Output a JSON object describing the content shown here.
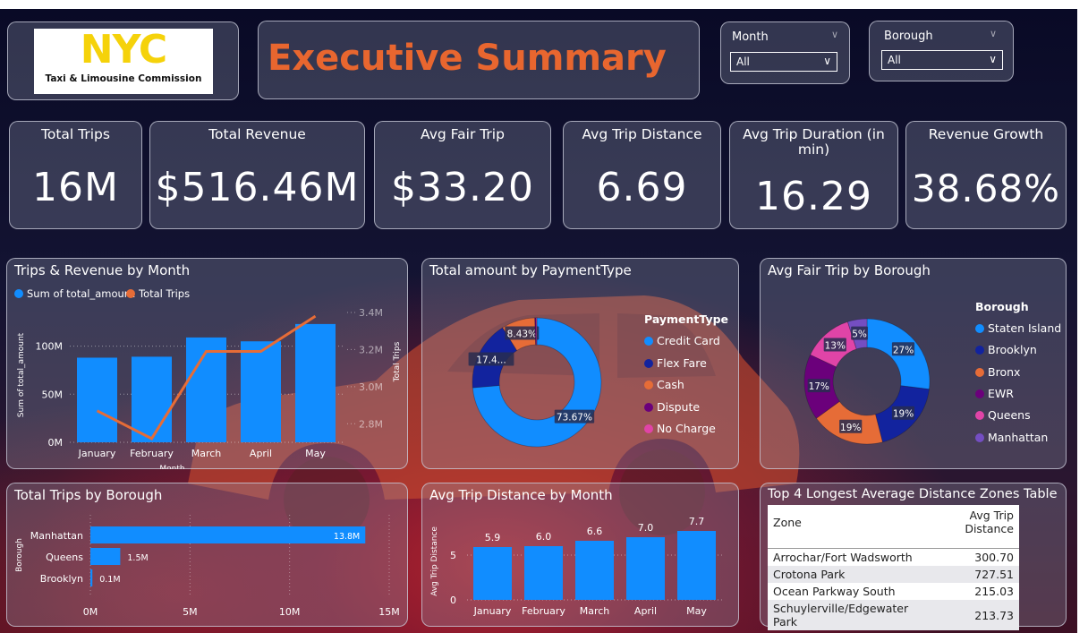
{
  "logo": {
    "brand": "NYC",
    "subtitle": "Taxi & Limousine Commission"
  },
  "header": {
    "title": "Executive Summary"
  },
  "slicers": [
    {
      "label": "Month",
      "value": "All"
    },
    {
      "label": "Borough",
      "value": "All"
    }
  ],
  "kpis": [
    {
      "title": "Total Trips",
      "value": "16M"
    },
    {
      "title": "Total Revenue",
      "value": "$516.46M"
    },
    {
      "title": "Avg Fair Trip",
      "value": "$33.20"
    },
    {
      "title": "Avg Trip Distance",
      "value": "6.69"
    },
    {
      "title": "Avg Trip Duration (in min)",
      "value": "16.29"
    },
    {
      "title": "Revenue Growth",
      "value": "38.68%"
    }
  ],
  "colors": {
    "blue": "#118dff",
    "navy": "#12239e",
    "orange": "#e66c37",
    "purple": "#6b007b",
    "pink": "#e044a7",
    "darkpurple": "#744ec2",
    "title_orange": "#e8662f"
  },
  "chart_data": [
    {
      "type": "bar",
      "title": "Trips & Revenue by Month",
      "categories": [
        "January",
        "February",
        "March",
        "April",
        "May"
      ],
      "series": [
        {
          "name": "Sum of total_amount",
          "type": "bar",
          "values": [
            88,
            89,
            109,
            105,
            123
          ]
        },
        {
          "name": "Total Trips",
          "type": "line",
          "values": [
            2.87,
            2.72,
            3.19,
            3.19,
            3.38
          ]
        }
      ],
      "xlabel": "Month",
      "ylabel": "Sum of total_amount",
      "y2label": "Total Trips",
      "yticks": [
        "0M",
        "50M",
        "100M"
      ],
      "y2ticks": [
        "2.8M",
        "3.0M",
        "3.2M",
        "3.4M"
      ],
      "ylim": [
        0,
        135
      ],
      "y2lim": [
        2.7,
        3.4
      ]
    },
    {
      "type": "pie",
      "title": "Total amount by PaymentType",
      "legend_title": "PaymentType",
      "labels": [
        "Credit Card",
        "Flex Fare",
        "Cash",
        "Dispute",
        "No Charge"
      ],
      "values": [
        73.67,
        17.4,
        8.43,
        0.3,
        0.2
      ],
      "data_labels": [
        "73.67%",
        "17.4...",
        "8.43%",
        "",
        ""
      ]
    },
    {
      "type": "pie",
      "title": "Avg Fair Trip by Borough",
      "legend_title": "Borough",
      "labels": [
        "Staten Island",
        "Brooklyn",
        "Bronx",
        "EWR",
        "Queens",
        "Manhattan"
      ],
      "values": [
        27,
        19,
        19,
        17,
        13,
        5
      ],
      "data_labels": [
        "27%",
        "19%",
        "19%",
        "17%",
        "13%",
        "5%"
      ]
    },
    {
      "type": "bar",
      "orientation": "horizontal",
      "title": "Total Trips by Borough",
      "categories": [
        "Manhattan",
        "Queens",
        "Brooklyn"
      ],
      "values": [
        13.8,
        1.5,
        0.1
      ],
      "data_labels": [
        "13.8M",
        "1.5M",
        "0.1M"
      ],
      "xticks": [
        "0M",
        "5M",
        "10M",
        "15M"
      ],
      "xlim": [
        0,
        15
      ],
      "ylabel": "Borough"
    },
    {
      "type": "bar",
      "title": "Avg Trip Distance by Month",
      "categories": [
        "January",
        "February",
        "March",
        "April",
        "May"
      ],
      "values": [
        5.9,
        6.0,
        6.6,
        7.0,
        7.7
      ],
      "data_labels": [
        "5.9",
        "6.0",
        "6.6",
        "7.0",
        "7.7"
      ],
      "ylabel": "Avg Trip Distance",
      "yticks": [
        "0",
        "5"
      ],
      "ylim": [
        0,
        9
      ]
    },
    {
      "type": "table",
      "title": "Top 4 Longest Average Distance Zones Table",
      "columns": [
        "Zone",
        "Avg Trip Distance"
      ],
      "rows": [
        [
          "Arrochar/Fort Wadsworth",
          "300.70"
        ],
        [
          "Crotona Park",
          "727.51"
        ],
        [
          "Ocean Parkway South",
          "215.03"
        ],
        [
          "Schuylerville/Edgewater Park",
          "213.73"
        ]
      ]
    }
  ]
}
